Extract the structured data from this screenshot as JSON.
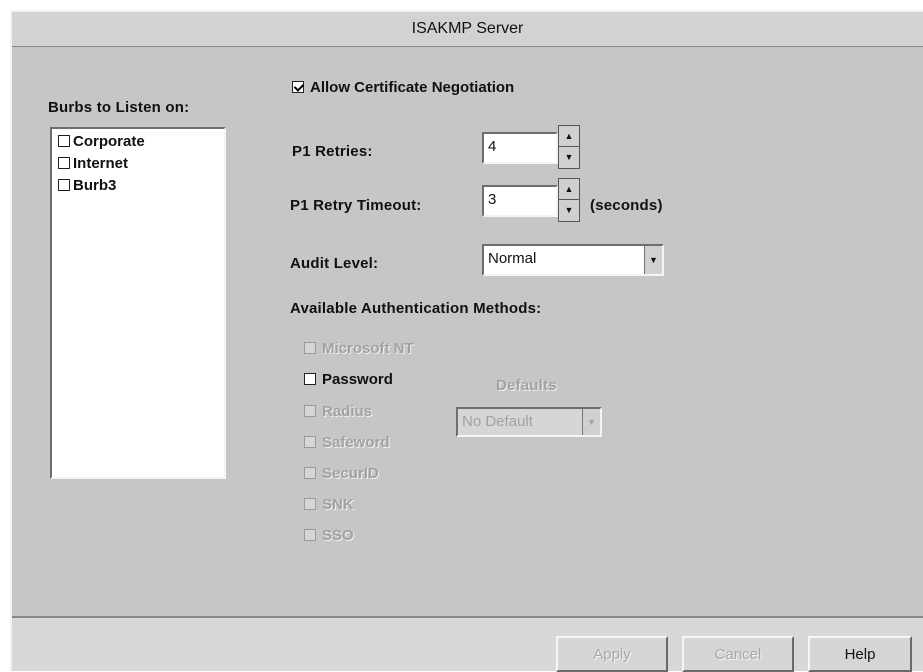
{
  "window": {
    "title": "ISAKMP Server"
  },
  "ports": {
    "label": "Burbs to Listen on:",
    "items": [
      {
        "label": "Corporate",
        "checked": false
      },
      {
        "label": "Internet",
        "checked": false
      },
      {
        "label": "Burb3",
        "checked": false
      }
    ]
  },
  "cert_negotiation": {
    "label": "Allow Certificate Negotiation",
    "checked": true
  },
  "p1_retries": {
    "label": "P1 Retries:",
    "value": "4"
  },
  "p1_retry_timeout": {
    "label": "P1 Retry Timeout:",
    "value": "3",
    "unit": "(seconds)"
  },
  "audit_level": {
    "label": "Audit Level:",
    "value": "Normal"
  },
  "auth_methods": {
    "label": "Available Authentication Methods:",
    "items": [
      {
        "label": "Microsoft NT",
        "checked": false,
        "enabled": false
      },
      {
        "label": "Password",
        "checked": false,
        "enabled": true
      },
      {
        "label": "Radius",
        "checked": false,
        "enabled": false
      },
      {
        "label": "Safeword",
        "checked": false,
        "enabled": false
      },
      {
        "label": "SecurID",
        "checked": false,
        "enabled": false
      },
      {
        "label": "SNK",
        "checked": false,
        "enabled": false
      },
      {
        "label": "SSO",
        "checked": false,
        "enabled": false
      }
    ]
  },
  "defaults": {
    "label": "Defaults",
    "value": "No Default"
  },
  "buttons": {
    "apply": "Apply",
    "cancel": "Cancel",
    "help": "Help"
  },
  "colors": {
    "window_bg": "#c6c6c6",
    "field_bg": "#ffffff",
    "disabled_text": "#a2a2a2"
  }
}
